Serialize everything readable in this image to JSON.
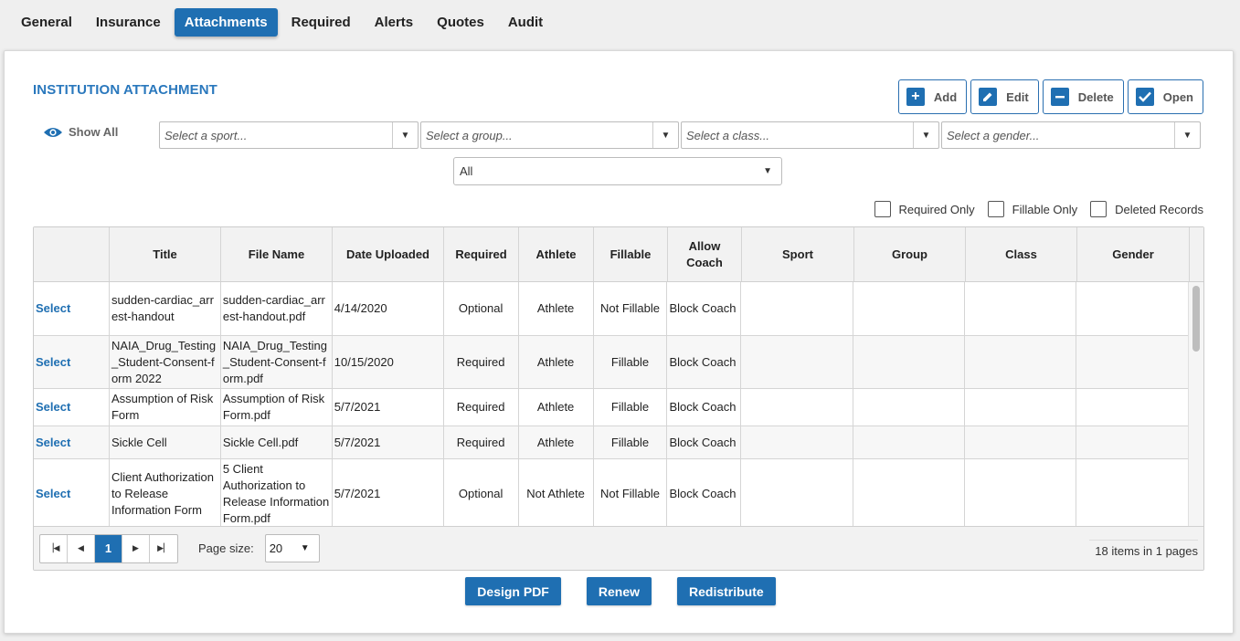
{
  "tabs": [
    {
      "label": "General",
      "active": false
    },
    {
      "label": "Insurance",
      "active": false
    },
    {
      "label": "Attachments",
      "active": true
    },
    {
      "label": "Required",
      "active": false
    },
    {
      "label": "Alerts",
      "active": false
    },
    {
      "label": "Quotes",
      "active": false
    },
    {
      "label": "Audit",
      "active": false
    }
  ],
  "section_title": "INSTITUTION ATTACHMENT",
  "toolbar": {
    "add": "Add",
    "edit": "Edit",
    "delete": "Delete",
    "open": "Open"
  },
  "show_all": "Show All",
  "filters": {
    "sport": "Select a sport...",
    "group": "Select a group...",
    "class": "Select a class...",
    "gender": "Select a gender...",
    "status": "All"
  },
  "checkboxes": {
    "required_only": "Required Only",
    "fillable_only": "Fillable Only",
    "deleted_records": "Deleted Records"
  },
  "columns": [
    "",
    "Title",
    "File Name",
    "Date Uploaded",
    "Required",
    "Athlete",
    "Fillable",
    "Allow Coach",
    "Sport",
    "Group",
    "Class",
    "Gender"
  ],
  "rows": [
    {
      "select": "Select",
      "title": "sudden-cardiac_arrest-handout",
      "file": "sudden-cardiac_arrest-handout.pdf",
      "date": "4/14/2020",
      "required": "Optional",
      "athlete": "Athlete",
      "fillable": "Not Fillable",
      "coach": "Block Coach",
      "sport": "",
      "group": "",
      "class": "",
      "gender": ""
    },
    {
      "select": "Select",
      "title": "NAIA_Drug_Testing_Student-Consent-form 2022",
      "file": "NAIA_Drug_Testing_Student-Consent-form.pdf",
      "date": "10/15/2020",
      "required": "Required",
      "athlete": "Athlete",
      "fillable": "Fillable",
      "coach": "Block Coach",
      "sport": "",
      "group": "",
      "class": "",
      "gender": ""
    },
    {
      "select": "Select",
      "title": "Assumption of Risk Form",
      "file": "Assumption of Risk Form.pdf",
      "date": "5/7/2021",
      "required": "Required",
      "athlete": "Athlete",
      "fillable": "Fillable",
      "coach": "Block Coach",
      "sport": "",
      "group": "",
      "class": "",
      "gender": ""
    },
    {
      "select": "Select",
      "title": "Sickle Cell",
      "file": "Sickle Cell.pdf",
      "date": "5/7/2021",
      "required": "Required",
      "athlete": "Athlete",
      "fillable": "Fillable",
      "coach": "Block Coach",
      "sport": "",
      "group": "",
      "class": "",
      "gender": ""
    },
    {
      "select": "Select",
      "title": "Client Authorization to Release Information Form",
      "file": "5 Client Authorization to Release Information Form.pdf",
      "date": "5/7/2021",
      "required": "Optional",
      "athlete": "Not Athlete",
      "fillable": "Not Fillable",
      "coach": "Block Coach",
      "sport": "",
      "group": "",
      "class": "",
      "gender": ""
    }
  ],
  "pager": {
    "current_page": "1",
    "page_size_label": "Page size:",
    "page_size": "20",
    "info": "18 items in 1 pages"
  },
  "actions": {
    "design_pdf": "Design PDF",
    "renew": "Renew",
    "redistribute": "Redistribute"
  },
  "colors": {
    "accent": "#1f6fb2",
    "title": "#2a78bd"
  }
}
